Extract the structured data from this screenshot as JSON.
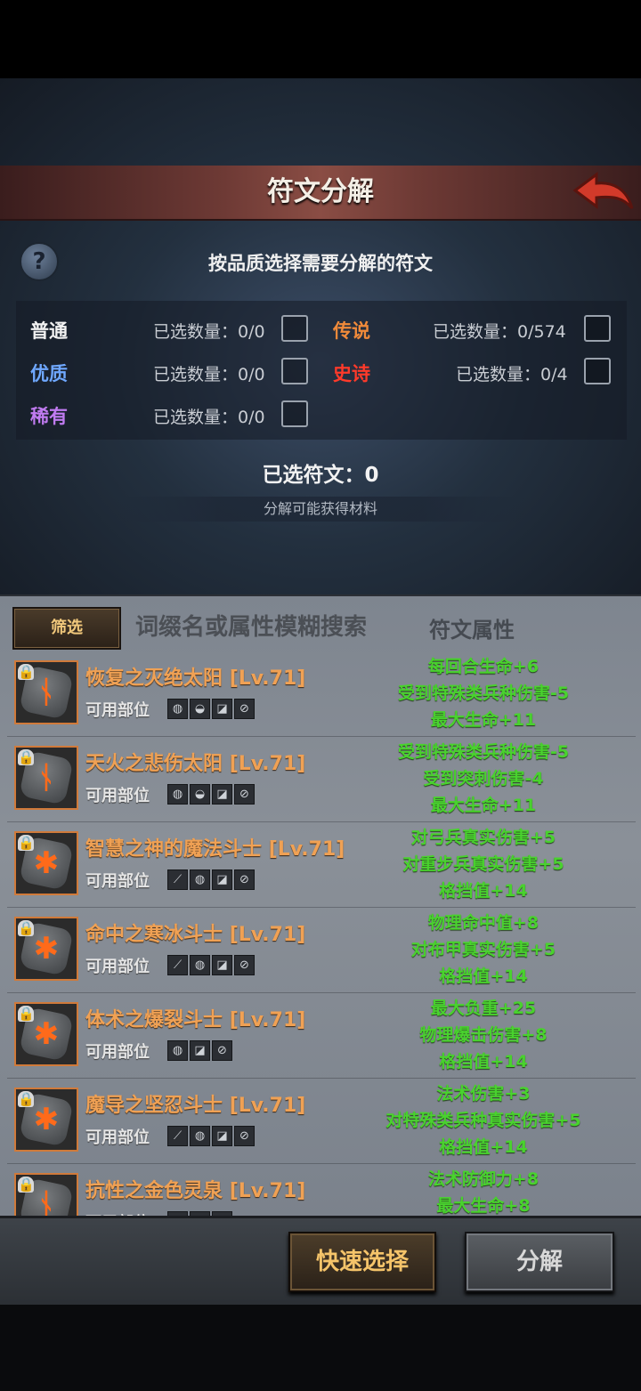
{
  "header": {
    "title": "符文分解"
  },
  "instruction": "按品质选择需要分解的符文",
  "qualities": [
    {
      "label": "普通",
      "count": "已选数量：0/0",
      "color": "#f2f2f2"
    },
    {
      "label": "优质",
      "count": "已选数量：0/0",
      "color": "#6fa8ff"
    },
    {
      "label": "稀有",
      "count": "已选数量：0/0",
      "color": "#c07bf0"
    },
    {
      "label": "传说",
      "count": "已选数量：0/574",
      "color": "#f08a3a"
    },
    {
      "label": "史诗",
      "count": "已选数量：0/4",
      "color": "#ff3a2a"
    }
  ],
  "selected_runes": "已选符文：0",
  "materials_label": "分解可能获得材料",
  "filter": {
    "button_label": "筛选",
    "search_placeholder": "词缀名或属性模糊搜索",
    "attr_header": "符文属性"
  },
  "slot_label": "可用部位",
  "runes": [
    {
      "name": "恢复之灭绝太阳",
      "level": "[Lv.71]",
      "glyph": "ᚾ",
      "slots": [
        "◍",
        "◒",
        "◪",
        "⊘"
      ],
      "attrs": [
        "每回合生命+6",
        "受到特殊类兵种伤害-5",
        "最大生命+11"
      ]
    },
    {
      "name": "天火之悲伤太阳",
      "level": "[Lv.71]",
      "glyph": "ᚾ",
      "slots": [
        "◍",
        "◒",
        "◪",
        "⊘"
      ],
      "attrs": [
        "受到特殊类兵种伤害-5",
        "受到突刺伤害-4",
        "最大生命+11"
      ]
    },
    {
      "name": "智慧之神的魔法斗士",
      "level": "[Lv.71]",
      "glyph": "✱",
      "slots": [
        "⟋",
        "◍",
        "◪",
        "⊘"
      ],
      "attrs": [
        "对弓兵真实伤害+5",
        "对重步兵真实伤害+5",
        "格挡值+14"
      ]
    },
    {
      "name": "命中之寒冰斗士",
      "level": "[Lv.71]",
      "glyph": "✱",
      "slots": [
        "⟋",
        "◍",
        "◪",
        "⊘"
      ],
      "attrs": [
        "物理命中值+8",
        "对布甲真实伤害+5",
        "格挡值+14"
      ]
    },
    {
      "name": "体术之爆裂斗士",
      "level": "[Lv.71]",
      "glyph": "✱",
      "slots": [
        "◍",
        "◪",
        "⊘"
      ],
      "attrs": [
        "最大负重+25",
        "物理爆击伤害+8",
        "格挡值+14"
      ]
    },
    {
      "name": "魔导之坚忍斗士",
      "level": "[Lv.71]",
      "glyph": "✱",
      "slots": [
        "⟋",
        "◍",
        "◪",
        "⊘"
      ],
      "attrs": [
        "法术伤害+3",
        "对特殊类兵种真实伤害+5",
        "格挡值+14"
      ]
    },
    {
      "name": "抗性之金色灵泉",
      "level": "[Lv.71]",
      "glyph": "ᚾ",
      "slots": [
        "◍",
        "◪",
        "⊘"
      ],
      "attrs": [
        "法术防御力+8",
        "最大生命+8"
      ]
    }
  ],
  "actions": {
    "quick_select": "快速选择",
    "decompose": "分解"
  }
}
